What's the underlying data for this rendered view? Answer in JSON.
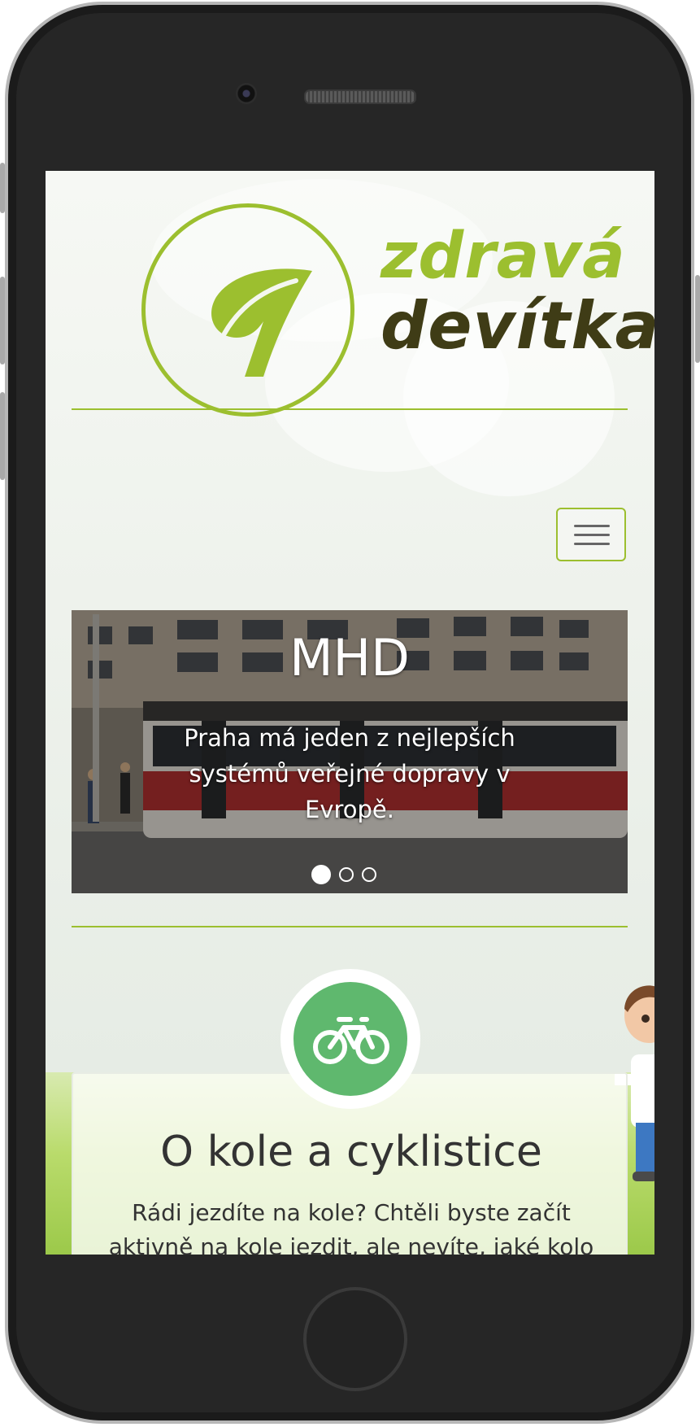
{
  "logo": {
    "line1": "zdravá",
    "line2": "devítka",
    "colors": {
      "green": "#9cbf2f",
      "dark": "#3f3c16"
    }
  },
  "nav": {
    "toggle_icon": "hamburger-icon"
  },
  "carousel": {
    "slides": [
      {
        "title": "MHD",
        "caption": "Praha má jeden z nejlepších systémů veřejné dopravy v Evropě."
      }
    ],
    "slide_count": 3,
    "active_index": 0
  },
  "feature": {
    "icon": "bicycle-icon",
    "icon_color": "#5fb86e",
    "title": "O kole a cyklistice",
    "text": "Rádi jezdíte na kole? Chtěli byste začít aktivně na kole jezdit, ale nevíte, jaké kolo"
  }
}
